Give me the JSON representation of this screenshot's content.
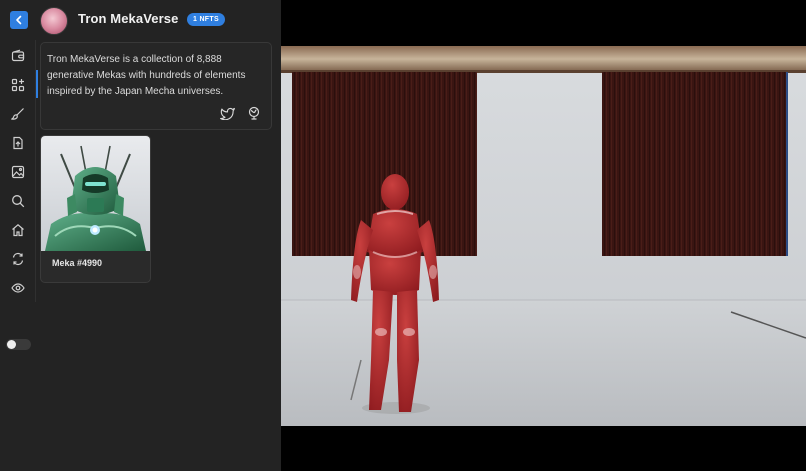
{
  "header": {
    "collection_title": "Tron MekaVerse",
    "count_badge": "1 NFTS"
  },
  "description": {
    "text": "Tron MekaVerse is a collection of 8,888 generative Mekas with hundreds of elements inspired by the Japan Mecha universes."
  },
  "social_links": [
    "twitter-icon",
    "globe-icon"
  ],
  "sidebar": {
    "items": [
      {
        "icon": "wallet-icon"
      },
      {
        "icon": "apps-icon"
      },
      {
        "icon": "brush-icon"
      },
      {
        "icon": "upload-icon"
      },
      {
        "icon": "image-icon"
      },
      {
        "icon": "search-icon"
      },
      {
        "icon": "home-icon"
      },
      {
        "icon": "swap-icon"
      },
      {
        "icon": "eye-icon"
      }
    ],
    "toggle_on": false
  },
  "nfts": [
    {
      "name": "Meka #4990"
    }
  ],
  "colors": {
    "accent": "#2f7fe0",
    "panel": "#232323",
    "viewport_wall": "#cfd2d6",
    "avatar_body": "#b5262c"
  }
}
